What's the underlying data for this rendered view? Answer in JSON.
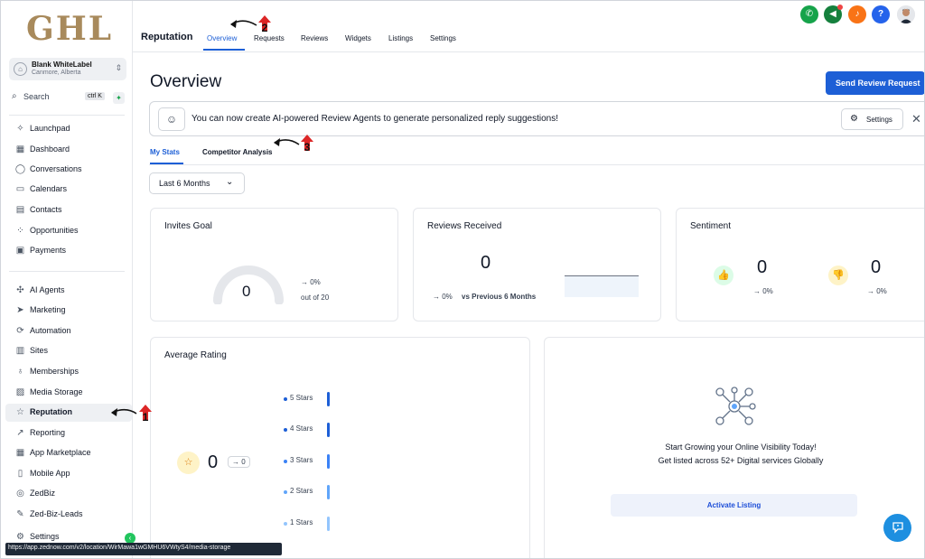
{
  "app": {
    "logo": "GHL",
    "account_name": "Blank WhiteLabel",
    "account_location": "Canmore, Alberta",
    "search_placeholder": "Search",
    "search_shortcut": "ctrl K"
  },
  "sidebar": {
    "items": [
      {
        "label": "Launchpad",
        "icon": "rocket-icon"
      },
      {
        "label": "Dashboard",
        "icon": "grid-icon"
      },
      {
        "label": "Conversations",
        "icon": "chat-icon"
      },
      {
        "label": "Calendars",
        "icon": "calendar-icon"
      },
      {
        "label": "Contacts",
        "icon": "contacts-icon"
      },
      {
        "label": "Opportunities",
        "icon": "opportunities-icon"
      },
      {
        "label": "Payments",
        "icon": "payments-icon"
      },
      {
        "label": "AI Agents",
        "icon": "sparkle-icon"
      },
      {
        "label": "Marketing",
        "icon": "send-icon"
      },
      {
        "label": "Automation",
        "icon": "automation-icon"
      },
      {
        "label": "Sites",
        "icon": "sites-icon"
      },
      {
        "label": "Memberships",
        "icon": "membership-icon"
      },
      {
        "label": "Media Storage",
        "icon": "image-icon"
      },
      {
        "label": "Reputation",
        "icon": "star-icon"
      },
      {
        "label": "Reporting",
        "icon": "trend-icon"
      },
      {
        "label": "App Marketplace",
        "icon": "apps-icon"
      },
      {
        "label": "Mobile App",
        "icon": "mobile-icon"
      },
      {
        "label": "ZedBiz",
        "icon": "zedbiz-icon"
      },
      {
        "label": "Zed-Biz-Leads",
        "icon": "wrench-icon"
      },
      {
        "label": "Settings",
        "icon": "gear-icon"
      }
    ],
    "active": "Reputation"
  },
  "topbar": {
    "title": "Reputation",
    "tabs": [
      "Overview",
      "Requests",
      "Reviews",
      "Widgets",
      "Listings",
      "Settings"
    ],
    "active_tab": "Overview"
  },
  "main": {
    "title": "Overview",
    "send_button": "Send Review Request",
    "banner_text": "You can now create AI-powered Review Agents to generate personalized reply suggestions!",
    "banner_settings": "Settings",
    "sub_tabs": [
      "My Stats",
      "Competitor Analysis"
    ],
    "range": "Last 6 Months"
  },
  "invites": {
    "title": "Invites Goal",
    "value": "0",
    "change": "→ 0%",
    "goal": "out of 20",
    "progress_fraction": 0
  },
  "reviews": {
    "title": "Reviews Received",
    "value": "0",
    "change": "→ 0%",
    "compare": "vs Previous 6 Months"
  },
  "sentiment": {
    "title": "Sentiment",
    "positive": "0",
    "positive_change": "→ 0%",
    "negative": "0",
    "negative_change": "→ 0%"
  },
  "rating": {
    "title": "Average Rating",
    "value": "0",
    "change": "→ 0",
    "rows": [
      {
        "label": "5 Stars",
        "color": "#1d5fd6"
      },
      {
        "label": "4 Stars",
        "color": "#1d5fd6"
      },
      {
        "label": "3 Stars",
        "color": "#3b82f6"
      },
      {
        "label": "2 Stars",
        "color": "#60a5fa"
      },
      {
        "label": "1 Stars",
        "color": "#93c5fd"
      }
    ]
  },
  "listing": {
    "line1": "Start Growing your Online Visibility Today!",
    "line2": "Get listed across 52+ Digital services Globally",
    "button": "Activate Listing"
  },
  "status_url": "https://app.zednow.com/v2/location/WirMawa1wGMHU6VWtyS4/media-storage",
  "annotations": [
    "1",
    "2",
    "3"
  ],
  "colors": {
    "accent": "#1d5fd6",
    "phone": "#16a34a",
    "megaphone": "#15803d",
    "bell": "#f97316",
    "help": "#2563eb"
  }
}
